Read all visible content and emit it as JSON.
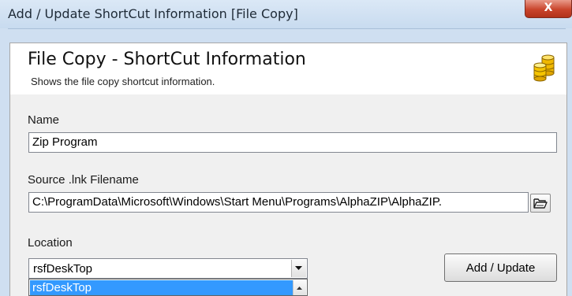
{
  "window": {
    "title": "Add / Update ShortCut Information [File Copy]",
    "close_label": "X"
  },
  "header": {
    "title": "File Copy - ShortCut Information",
    "subtitle": "Shows the file copy shortcut information.",
    "icon": "database-icon"
  },
  "form": {
    "name_label": "Name",
    "name_value": "Zip Program",
    "source_label": "Source .lnk Filename",
    "source_value": "C:\\ProgramData\\Microsoft\\Windows\\Start Menu\\Programs\\AlphaZIP\\AlphaZIP.",
    "browse_icon": "folder-open-icon",
    "location_label": "Location",
    "location_value": "rsfDeskTop",
    "location_options": [
      "rsfDeskTop"
    ],
    "add_update_label": "Add / Update"
  },
  "colors": {
    "selection": "#3399ff",
    "close_button": "#c9452c",
    "frame": "#cfdff1"
  }
}
